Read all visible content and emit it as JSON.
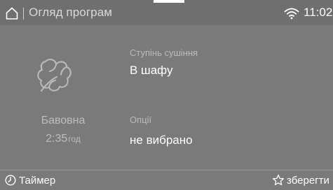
{
  "header": {
    "title": "Огляд програм",
    "time": "11:02",
    "icons": {
      "home": "home-icon",
      "wifi": "wifi-icon"
    }
  },
  "program": {
    "icon": "cotton-icon",
    "name": "Бавовна",
    "duration": "2:35",
    "duration_unit": "год"
  },
  "settings": {
    "drying_level": {
      "label": "Ступінь сушіння",
      "value": "В шафу"
    },
    "options": {
      "label": "Опції",
      "value": "не вибрано"
    }
  },
  "footer": {
    "timer": {
      "icon": "clock-icon",
      "label": "Таймер"
    },
    "save": {
      "icon": "star-icon",
      "label": "зберегти"
    }
  },
  "colors": {
    "background": "#7a7a7a",
    "topbar": "#6f6f6f",
    "text_primary": "#ffffff",
    "text_secondary": "#bcbcbc"
  }
}
